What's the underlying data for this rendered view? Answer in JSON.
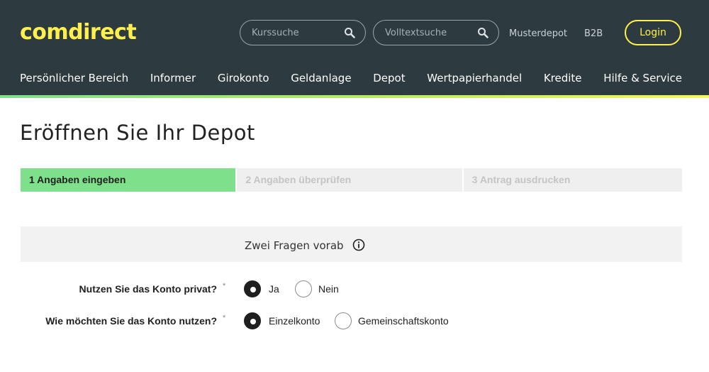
{
  "header": {
    "logo_text": "comdirect",
    "search_course_placeholder": "Kurssuche",
    "search_fulltext_placeholder": "Volltextsuche",
    "musterdepot_label": "Musterdepot",
    "b2b_label": "B2B",
    "login_label": "Login",
    "brand_color": "#fff04d",
    "background_color": "#2d3a3f"
  },
  "nav": {
    "items": [
      {
        "label": "Persönlicher Bereich"
      },
      {
        "label": "Informer"
      },
      {
        "label": "Girokonto"
      },
      {
        "label": "Geldanlage"
      },
      {
        "label": "Depot"
      },
      {
        "label": "Wertpapierhandel"
      },
      {
        "label": "Kredite"
      },
      {
        "label": "Hilfe & Service"
      }
    ]
  },
  "main": {
    "title": "Eröffnen Sie Ihr Depot",
    "steps": [
      {
        "label": "1 Angaben eingeben",
        "active": true
      },
      {
        "label": "2 Angaben überprüfen",
        "active": false
      },
      {
        "label": "3 Antrag ausdrucken",
        "active": false
      }
    ],
    "panel_title": "Zwei Fragen vorab",
    "questions": [
      {
        "label": "Nutzen Sie das Konto privat?",
        "required_mark": "*",
        "options": [
          {
            "label": "Ja",
            "selected": true
          },
          {
            "label": "Nein",
            "selected": false
          }
        ]
      },
      {
        "label": "Wie möchten Sie das Konto nutzen?",
        "required_mark": "*",
        "options": [
          {
            "label": "Einzelkonto",
            "selected": true
          },
          {
            "label": "Gemeinschaftskonto",
            "selected": false
          }
        ]
      }
    ],
    "active_step_color": "#7ee08a"
  }
}
